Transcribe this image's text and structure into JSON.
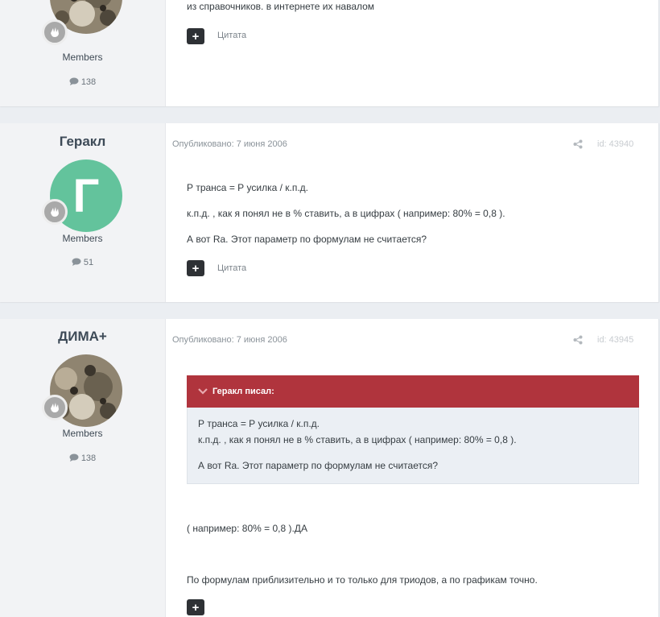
{
  "posts": [
    {
      "author": "",
      "group": "Members",
      "post_count": "138",
      "body": [
        "из справочников. в интернете их навалом"
      ],
      "quote_label": "Цитата",
      "plus_label": "+"
    },
    {
      "author": "Геракл",
      "avatar_letter": "Г",
      "group": "Members",
      "post_count": "51",
      "published": "Опубликовано: 7 июня 2006",
      "post_id": "id: 43940",
      "body": [
        "Р транса = Р усилка / к.п.д.",
        "к.п.д. , как я понял не в % ставить, а в цифрах ( например: 80% = 0,8 ).",
        "А вот Ra. Этот параметр по формулам не считается?"
      ],
      "quote_label": "Цитата",
      "plus_label": "+"
    },
    {
      "author": "ДИМА+",
      "group": "Members",
      "post_count": "138",
      "published": "Опубликовано: 7 июня 2006",
      "post_id": "id: 43945",
      "quote": {
        "header": "Геракл писал:",
        "lines": [
          "Р транса = Р усилка / к.п.д.",
          "к.п.д. , как я понял не в % ставить, а в цифрах ( например: 80% = 0,8 ).",
          "А вот Ra. Этот параметр по формулам не считается?"
        ]
      },
      "body": [
        "( например: 80% = 0,8 ).ДА",
        "По формулам приблизительно и то только для триодов, а по графикам точно."
      ],
      "plus_label": "+"
    }
  ],
  "colors": {
    "page_bg": "#ebeef2",
    "quote_header": "#b0343d",
    "letter_avatar": "#63c39c",
    "button_dark": "#2e3135"
  },
  "icons": [
    "comment-icon",
    "share-icon",
    "chevron-down-icon",
    "rank-badge-icon"
  ]
}
